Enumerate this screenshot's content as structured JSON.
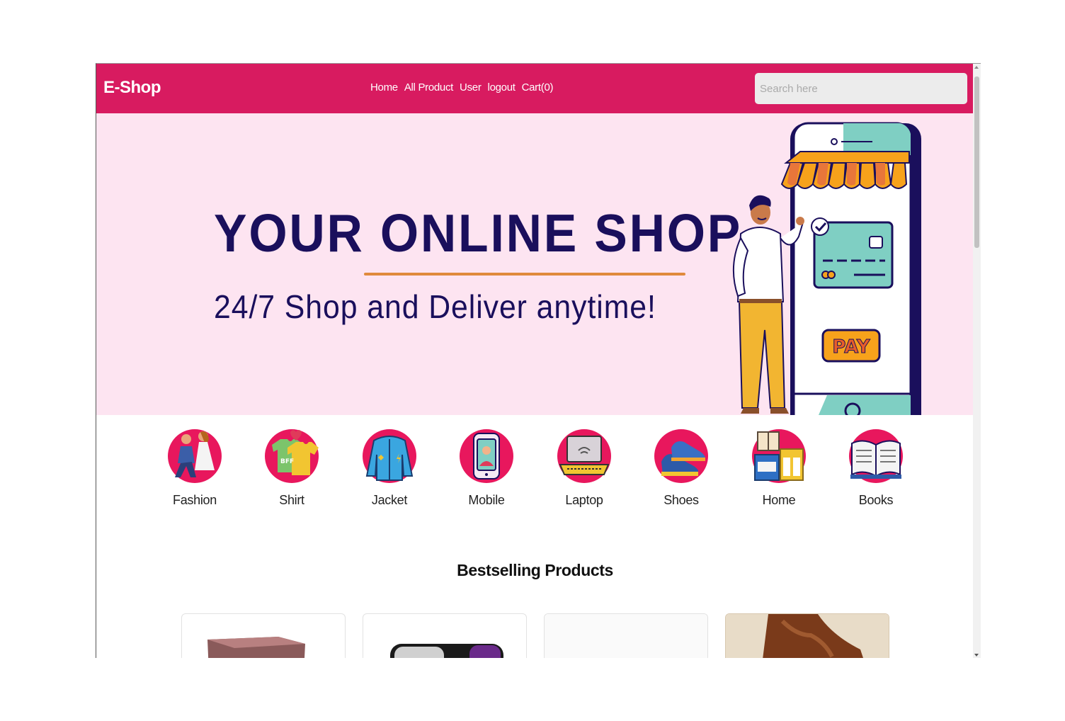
{
  "navbar": {
    "brand": "E-Shop",
    "links": [
      "Home",
      "All Product",
      "User",
      "logout",
      "Cart(0)"
    ],
    "search_placeholder": "Search here",
    "color": "#d81b60"
  },
  "hero": {
    "title": "YOUR ONLINE SHOP",
    "subtitle": "24/7 Shop and Deliver anytime!",
    "pay_button": "PAY",
    "background": "#fde4f1",
    "text_color": "#1a0f5c",
    "underline_color": "#e08a3c"
  },
  "categories": [
    {
      "label": "Fashion",
      "icon": "couple-icon"
    },
    {
      "label": "Shirt",
      "icon": "tshirt-icon"
    },
    {
      "label": "Jacket",
      "icon": "jacket-icon"
    },
    {
      "label": "Mobile",
      "icon": "mobile-icon"
    },
    {
      "label": "Laptop",
      "icon": "laptop-icon"
    },
    {
      "label": "Shoes",
      "icon": "shoes-icon"
    },
    {
      "label": "Home",
      "icon": "furniture-icon"
    },
    {
      "label": "Books",
      "icon": "book-icon"
    }
  ],
  "bestselling": {
    "title": "Bestselling Products",
    "products": [
      {
        "image": "bag-image"
      },
      {
        "image": "phone-image"
      },
      {
        "image": "blank-image"
      },
      {
        "image": "shoe-image"
      }
    ]
  }
}
